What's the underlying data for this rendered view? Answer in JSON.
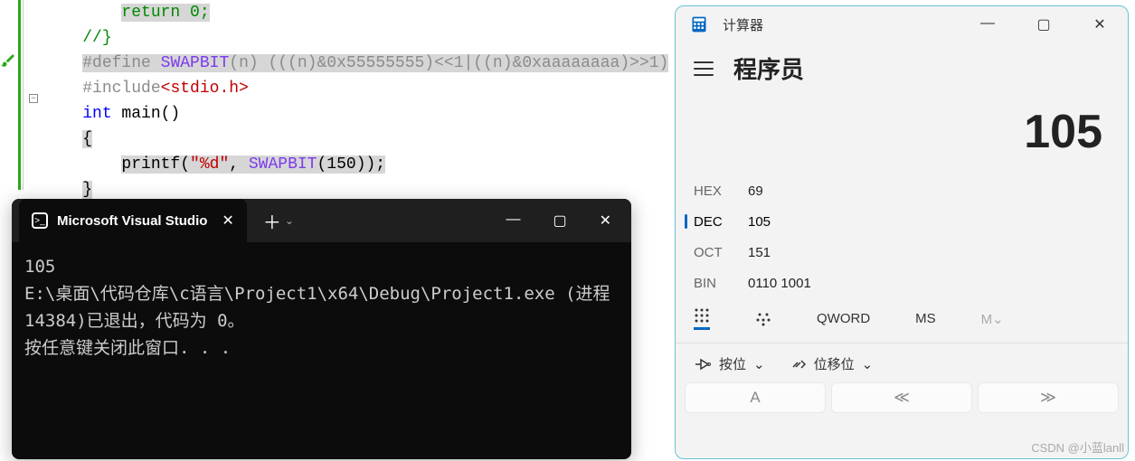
{
  "editor": {
    "lines": [
      {
        "indent": "        ",
        "parts": [
          {
            "cls": "tok-comment",
            "t": "return 0;"
          }
        ],
        "sel": true
      },
      {
        "indent": "    ",
        "parts": [
          {
            "cls": "tok-comment",
            "t": "//}"
          }
        ]
      },
      {
        "indent": "    ",
        "parts": [
          {
            "cls": "tok-preproc",
            "t": "#define "
          },
          {
            "cls": "tok-macro",
            "t": "SWAPBIT"
          },
          {
            "cls": "tok-op",
            "t": "(n) (((n)&0x55555555)<<1|((n)&0xaaaaaaaa)>>1)"
          }
        ],
        "sel": true
      },
      {
        "indent": "    ",
        "parts": [
          {
            "cls": "tok-preproc",
            "t": "#include"
          },
          {
            "cls": "tok-string",
            "t": "<stdio.h>"
          }
        ]
      },
      {
        "indent": "    ",
        "parts": [
          {
            "cls": "tok-keyword",
            "t": "int"
          },
          {
            "cls": "",
            "t": " main()"
          }
        ]
      },
      {
        "indent": "    ",
        "parts": [
          {
            "cls": "",
            "t": "{"
          }
        ],
        "sel": true
      },
      {
        "indent": "        ",
        "parts": [
          {
            "cls": "tok-func",
            "t": "printf"
          },
          {
            "cls": "",
            "t": "("
          },
          {
            "cls": "tok-string",
            "t": "\"%d\""
          },
          {
            "cls": "",
            "t": ", "
          },
          {
            "cls": "tok-macro",
            "t": "SWAPBIT"
          },
          {
            "cls": "",
            "t": "(150));"
          }
        ],
        "sel": true
      },
      {
        "indent": "    ",
        "parts": [
          {
            "cls": "",
            "t": "}"
          }
        ],
        "sel": true
      }
    ]
  },
  "terminal": {
    "tab_title": "Microsoft Visual Studio",
    "output": "105\nE:\\桌面\\代码仓库\\c语言\\Project1\\x64\\Debug\\Project1.exe (进程 14384)已退出，代码为 0。\n按任意键关闭此窗口. . ."
  },
  "calc": {
    "app_title": "计算器",
    "mode": "程序员",
    "display": "105",
    "bases": [
      {
        "label": "HEX",
        "value": "69",
        "active": false
      },
      {
        "label": "DEC",
        "value": "105",
        "active": true
      },
      {
        "label": "OCT",
        "value": "151",
        "active": false
      },
      {
        "label": "BIN",
        "value": "0110 1001",
        "active": false
      }
    ],
    "toolbar": {
      "qword": "QWORD",
      "ms": "MS",
      "m": "M"
    },
    "bitops": {
      "bitwise": "按位",
      "bitshift": "位移位"
    },
    "keys": [
      "A",
      "≪",
      "≫"
    ]
  },
  "watermark": "CSDN @小蓝lanll"
}
